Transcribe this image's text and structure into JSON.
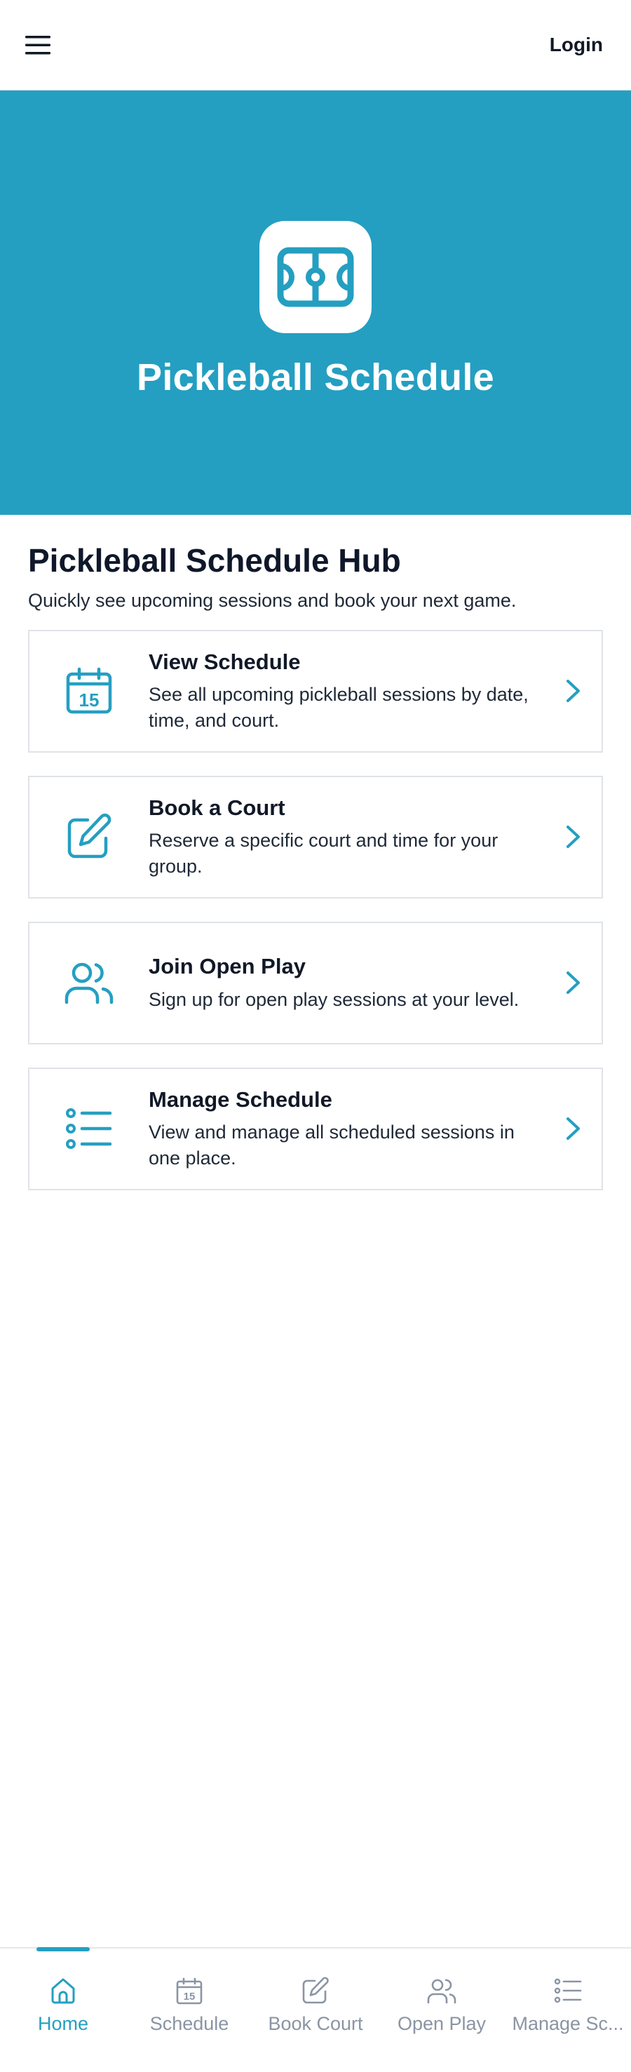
{
  "header": {
    "login_label": "Login"
  },
  "hero": {
    "title": "Pickleball Schedule"
  },
  "hub": {
    "title": "Pickleball Schedule Hub",
    "subtitle": "Quickly see upcoming sessions and book your next game."
  },
  "cards": [
    {
      "icon": "calendar-icon",
      "calendar_day": "15",
      "title": "View Schedule",
      "description": "See all upcoming pickleball sessions by date, time, and court."
    },
    {
      "icon": "edit-icon",
      "title": "Book a Court",
      "description": "Reserve a specific court and time for your group."
    },
    {
      "icon": "users-icon",
      "title": "Join Open Play",
      "description": "Sign up for open play sessions at your level."
    },
    {
      "icon": "list-icon",
      "title": "Manage Schedule",
      "description": "View and manage all scheduled sessions in one place."
    }
  ],
  "nav": {
    "items": [
      {
        "label": "Home",
        "icon": "home-icon",
        "active": true
      },
      {
        "label": "Schedule",
        "icon": "calendar-icon",
        "calendar_day": "15"
      },
      {
        "label": "Book Court",
        "icon": "edit-icon"
      },
      {
        "label": "Open Play",
        "icon": "users-icon"
      },
      {
        "label": "Manage Sc...",
        "icon": "list-icon"
      }
    ]
  },
  "colors": {
    "accent": "#249fc1",
    "inactive_nav": "#8a94a3",
    "text": "#0f172a"
  }
}
